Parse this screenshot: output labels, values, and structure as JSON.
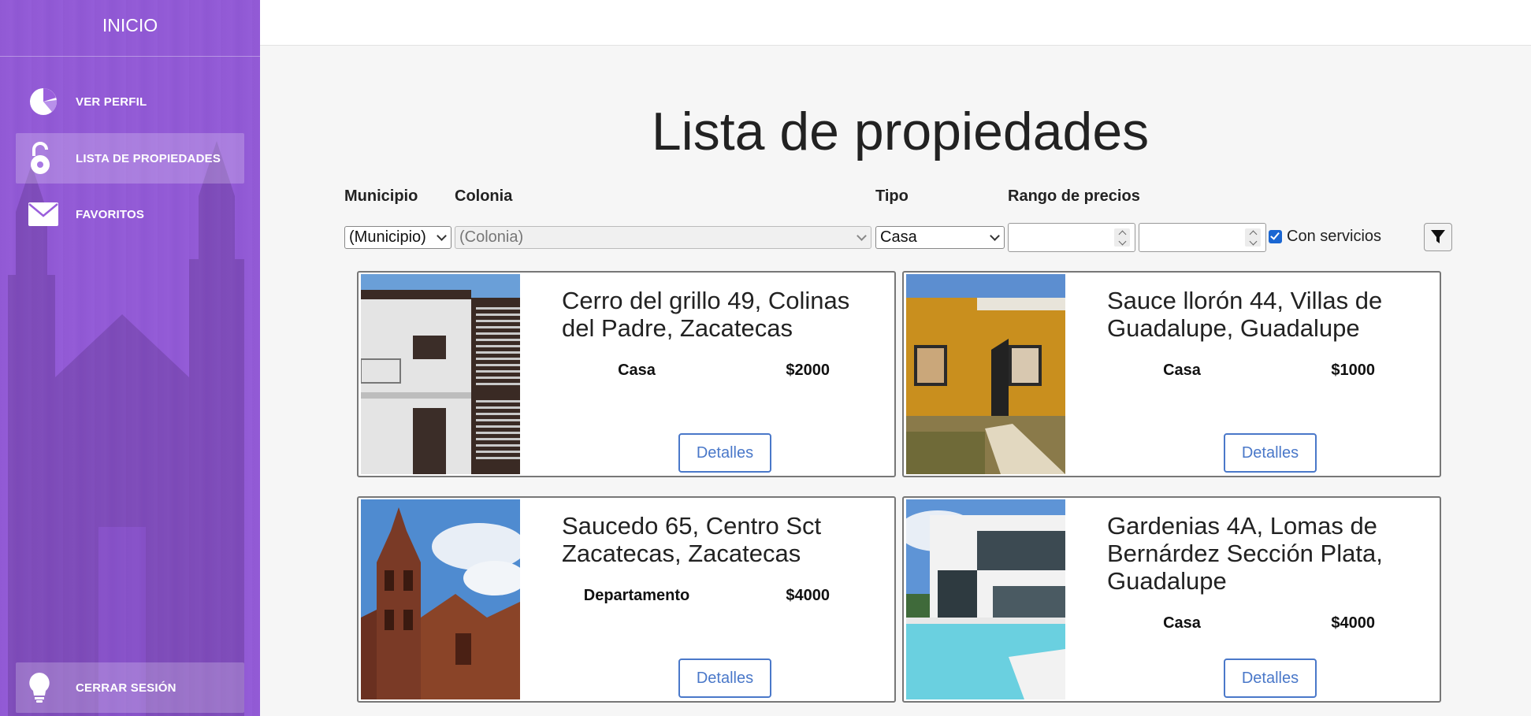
{
  "sidebar": {
    "title": "INICIO",
    "items": [
      {
        "label": "VER PERFIL",
        "icon": "pie-chart-icon"
      },
      {
        "label": "LISTA DE PROPIEDADES",
        "icon": "unlock-icon"
      },
      {
        "label": "FAVORITOS",
        "icon": "envelope-icon"
      }
    ],
    "logout": {
      "label": "CERRAR SESIÓN",
      "icon": "lightbulb-icon"
    }
  },
  "main": {
    "title": "Lista de propiedades",
    "filters": {
      "municipio_label": "Municipio",
      "colonia_label": "Colonia",
      "tipo_label": "Tipo",
      "rango_label": "Rango de precios",
      "municipio_value": "(Municipio)",
      "colonia_value": "(Colonia)",
      "tipo_value": "Casa",
      "precio_min": "",
      "precio_max": "",
      "servicios_label": "Con servicios",
      "servicios_checked": true,
      "filter_icon": "funnel-icon"
    },
    "properties": [
      {
        "address": "Cerro del grillo 49, Colinas del Padre, Zacatecas",
        "type": "Casa",
        "price": "$2000",
        "button": "Detalles"
      },
      {
        "address": "Sauce llorón 44, Villas de Guadalupe, Guadalupe",
        "type": "Casa",
        "price": "$1000",
        "button": "Detalles"
      },
      {
        "address": "Saucedo 65, Centro Sct Zacatecas, Zacatecas",
        "type": "Departamento",
        "price": "$4000",
        "button": "Detalles"
      },
      {
        "address": "Gardenias 4A, Lomas de Bernárdez Sección Plata, Guadalupe",
        "type": "Casa",
        "price": "$4000",
        "button": "Detalles"
      }
    ]
  },
  "colors": {
    "sidebar": "#9a5fdc",
    "accent": "#4a78c9",
    "checkbox": "#1a66d2"
  }
}
